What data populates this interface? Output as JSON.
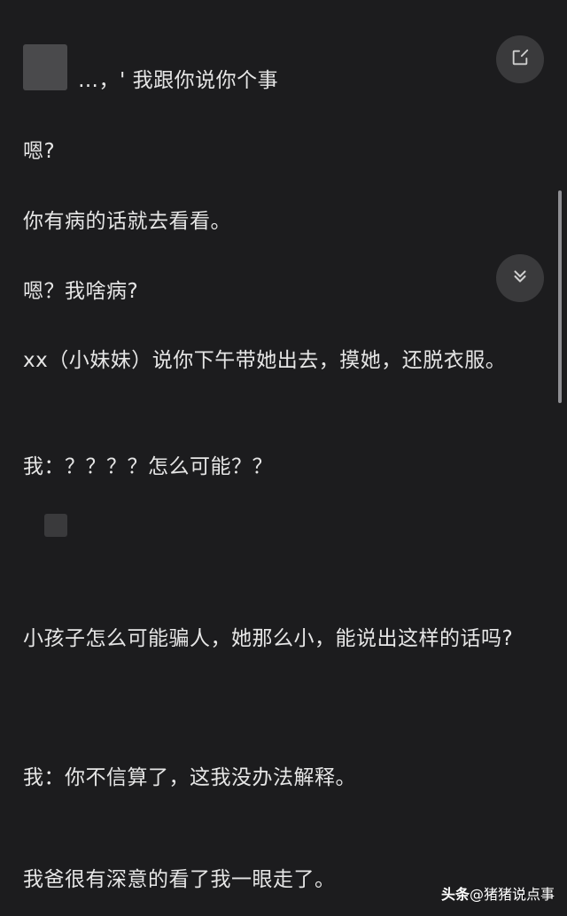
{
  "message": {
    "line1_visible": "…，' 我跟你说你个事",
    "line2": "嗯?",
    "line3": "你有病的话就去看看。",
    "line4": "嗯？我啥病?",
    "line5": "xx（小妹妹）说你下午带她出去，摸她，还脱衣服。",
    "line6": "我：？？？？怎么可能？？",
    "line7": "小孩子怎么可能骗人，她那么小，能说出这样的话吗?",
    "line8": "我：你不信算了，这我没办法解释。",
    "line9": "我爸很有深意的看了我一眼走了。"
  },
  "watermark": {
    "brand": "头条",
    "handle": "@猪猪说点事"
  },
  "icons": {
    "edit": "edit-icon",
    "scroll_down": "double-chevron-down-icon"
  },
  "colors": {
    "background": "#1c1c1e",
    "text": "#e6e6e6",
    "button": "#3a3a3c"
  }
}
